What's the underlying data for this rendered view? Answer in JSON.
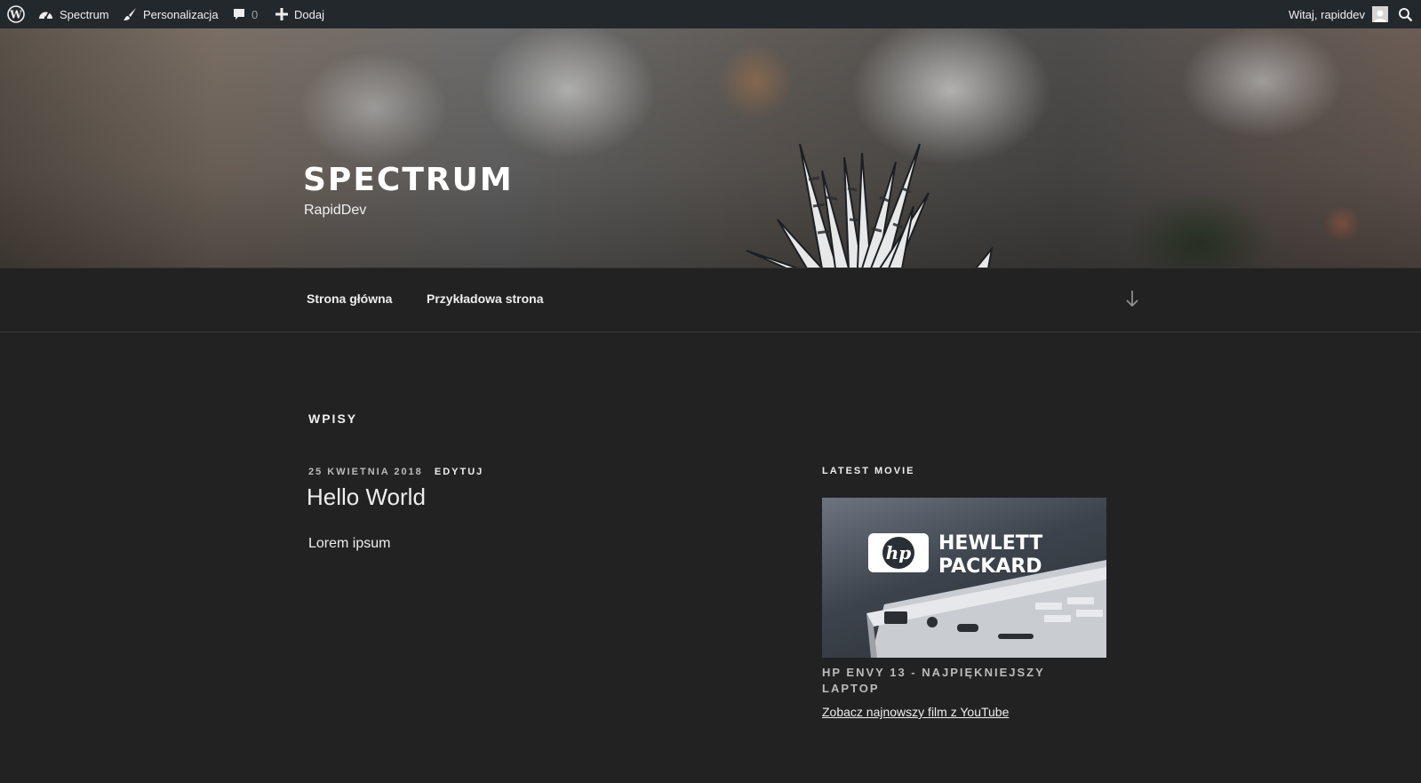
{
  "admin_bar": {
    "site_name": "Spectrum",
    "customize_label": "Personalizacja",
    "comments_count": "0",
    "new_label": "Dodaj",
    "greeting": "Witaj, rapiddev"
  },
  "header": {
    "site_title": "SPECTRUM",
    "site_description": "RapidDev"
  },
  "nav": {
    "items": [
      {
        "label": "Strona główna"
      },
      {
        "label": "Przykładowa strona"
      }
    ]
  },
  "main": {
    "section_title": "WPISY",
    "post": {
      "date": "25 KWIETNIA 2018",
      "edit_label": "EDYTUJ",
      "title": "Hello World",
      "excerpt": "Lorem ipsum"
    }
  },
  "sidebar": {
    "widget_title": "LATEST MOVIE",
    "movie": {
      "title": "HP ENVY 13 - NAJPIĘKNIEJSZY LAPTOP",
      "link_text": "Zobacz najnowszy film z YouTube",
      "thumbnail_brand_line1": "HEWLETT",
      "thumbnail_brand_line2": "PACKARD",
      "thumbnail_logo_text": "hp"
    }
  },
  "icons": {
    "wordpress": "wordpress-logo-icon",
    "dashboard": "dashboard-icon",
    "customize": "brush-icon",
    "comments": "comment-bubble-icon",
    "new": "plus-icon",
    "search": "search-icon",
    "scroll": "arrow-down-icon"
  },
  "colors": {
    "admin_bar_bg": "#23282d",
    "page_bg": "#222222",
    "text": "#eeeeee",
    "muted_text": "#bbbbbb"
  }
}
